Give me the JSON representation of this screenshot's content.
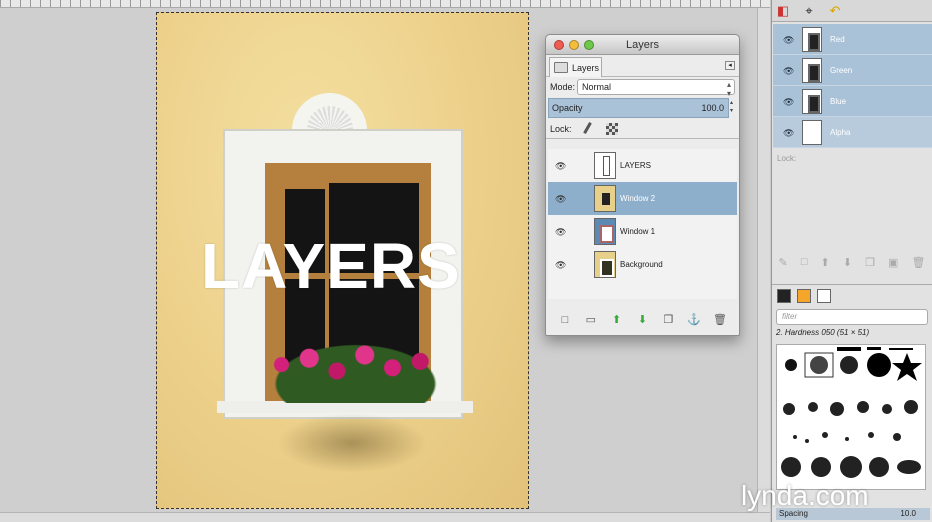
{
  "canvas": {
    "image_text": "LAYERS"
  },
  "layers_dialog": {
    "title": "Layers",
    "tab_label": "Layers",
    "mode_label": "Mode:",
    "mode_value": "Normal",
    "opacity_label": "Opacity",
    "opacity_value": "100.0",
    "lock_label": "Lock:",
    "layers": [
      {
        "name": "LAYERS",
        "selected": false
      },
      {
        "name": "Window 2",
        "selected": true
      },
      {
        "name": "Window 1",
        "selected": false
      },
      {
        "name": "Background",
        "selected": false
      }
    ]
  },
  "channels": [
    {
      "name": "Red"
    },
    {
      "name": "Green"
    },
    {
      "name": "Blue"
    },
    {
      "name": "Alpha"
    }
  ],
  "dock": {
    "lock_label": "Lock:",
    "filter_placeholder": "filter",
    "brush_name": "2. Hardness 050 (51 × 51)",
    "spacing_label": "Spacing",
    "spacing_value": "10.0"
  },
  "watermark": "lynda.com",
  "colors": {
    "selection": "#8eafcb",
    "channel_bg": "#a9c2d8",
    "canvas_bg": "#cfcfcf"
  }
}
